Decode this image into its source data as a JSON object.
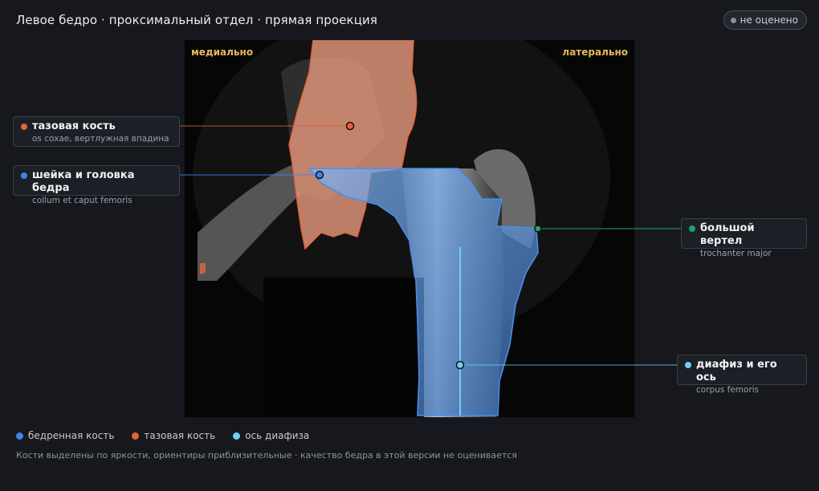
{
  "header": {
    "title": "Левое бедро · проксимальный отдел · прямая проекция",
    "status_badge": "не оценено"
  },
  "viewer": {
    "orientation_left": "медиально",
    "orientation_right": "латерально"
  },
  "annotations": [
    {
      "id": "pelvis",
      "name": "тазовая кость",
      "latin": "os coxae, вертлужная впадина",
      "color": "#e0643c"
    },
    {
      "id": "neck",
      "name": "шейка и головка бедра",
      "latin": "collum et caput femoris",
      "color": "#3f86e6"
    },
    {
      "id": "trochanter",
      "name": "большой вертел",
      "latin": "trochanter major",
      "color": "#24a36b"
    },
    {
      "id": "shaft",
      "name": "диафиз и его ось",
      "latin": "corpus femoris",
      "color": "#6cd0f5"
    }
  ],
  "legend": [
    {
      "label": "бедренная кость",
      "color": "#3f86e6"
    },
    {
      "label": "тазовая кость",
      "color": "#e0643c"
    },
    {
      "label": "ось диафиза",
      "color": "#6cd0f5"
    }
  ],
  "footer_note": "Кости выделены по яркости, ориентиры приблизительные · качество бедра в этой версии не оценивается"
}
